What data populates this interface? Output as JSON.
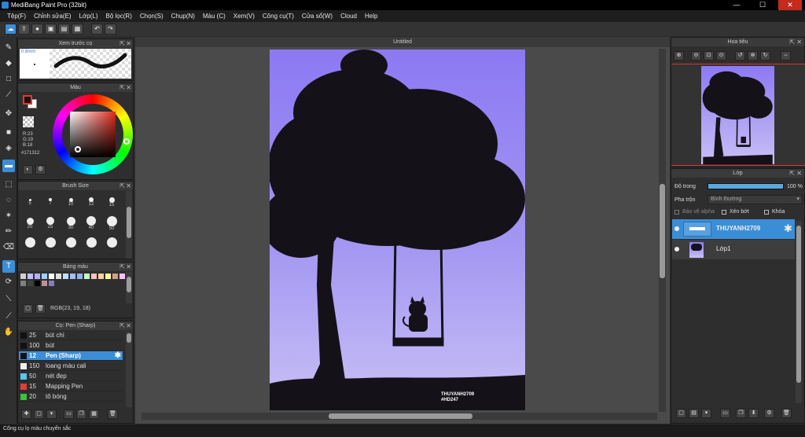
{
  "window": {
    "title": "MediBang Paint Pro (32bit)",
    "minimize": "—",
    "maximize": "☐",
    "close": "✕"
  },
  "menu": [
    "Tệp(F)",
    "Chỉnh sửa(E)",
    "Lớp(L)",
    "Bộ lọc(R)",
    "Chọn(S)",
    "Chụp(N)",
    "Màu (C)",
    "Xem(V)",
    "Công cụ(T)",
    "Cửa sổ(W)",
    "Cloud",
    "Help"
  ],
  "toolbar": {
    "icons": [
      "cloud-icon",
      "export-icon",
      "comment-icon",
      "save-icon",
      "save-as-icon",
      "grid-icon",
      "undo-icon",
      "redo-icon"
    ]
  },
  "preview": {
    "title": "Xem trước cọ",
    "size": "0.8mm"
  },
  "color": {
    "title": "Màu",
    "r": "R:23",
    "g": "G:19",
    "b": "B:18",
    "hex": "#171312",
    "fg": "#171312",
    "bg": "#ffffff"
  },
  "brush_size": {
    "title": "Brush Size",
    "sizes": [
      "5",
      "7",
      "10",
      "12",
      "15",
      "20",
      "25",
      "30",
      "40",
      "50",
      "",
      "",
      "",
      "",
      ""
    ]
  },
  "palette": {
    "title": "Bảng màu",
    "rgb": "RGB(23, 19, 18)",
    "colors": [
      "#d0d0d0",
      "#c0c0ff",
      "#b0b0ff",
      "#a0d0ff",
      "#ffffff",
      "#e0e0e0",
      "#c0e0ff",
      "#a0c0ff",
      "#90b0ff",
      "#c0ffc0",
      "#ffc0c0",
      "#ffd0a0",
      "#ffffa0",
      "#d0a080",
      "#ffc0ff",
      "#808080",
      "#404040",
      "#000000",
      "#c09090",
      "#8080c0"
    ]
  },
  "brushes": {
    "title": "Cọ: Pen (Sharp)",
    "items": [
      {
        "size": "25",
        "name": "bút chì",
        "color": "#111111"
      },
      {
        "size": "100",
        "name": "bút",
        "color": "#111111"
      },
      {
        "size": "12",
        "name": "Pen (Sharp)",
        "color": "#111111"
      },
      {
        "size": "150",
        "name": "loang màu cali",
        "color": "#f0f0f0"
      },
      {
        "size": "50",
        "name": "nét đẹp",
        "color": "#57c7f0"
      },
      {
        "size": "15",
        "name": "Mapping Pen",
        "color": "#e23c3c"
      },
      {
        "size": "20",
        "name": "tô bóng",
        "color": "#3fbf3f"
      }
    ]
  },
  "document": {
    "title": "Untitled",
    "watermark_line1": "THUYANH2709",
    "watermark_line2": "#HD247"
  },
  "navigator": {
    "title": "Hoa tiêu"
  },
  "layers": {
    "title": "Lớp",
    "opacity_label": "Độ trong",
    "opacity_value": "100 %",
    "opacity": 1.0,
    "blend_label": "Pha trộn",
    "blend_value": "Bình thường",
    "protect_alpha": "Bảo vệ alpha",
    "clipping": "Xén bớt",
    "lock": "Khóa",
    "items": [
      {
        "name": "THUYANH2709",
        "selected": true
      },
      {
        "name": "Lớp1",
        "selected": false
      }
    ]
  },
  "status": {
    "text": "Công cụ lọ màu chuyển sắc"
  }
}
